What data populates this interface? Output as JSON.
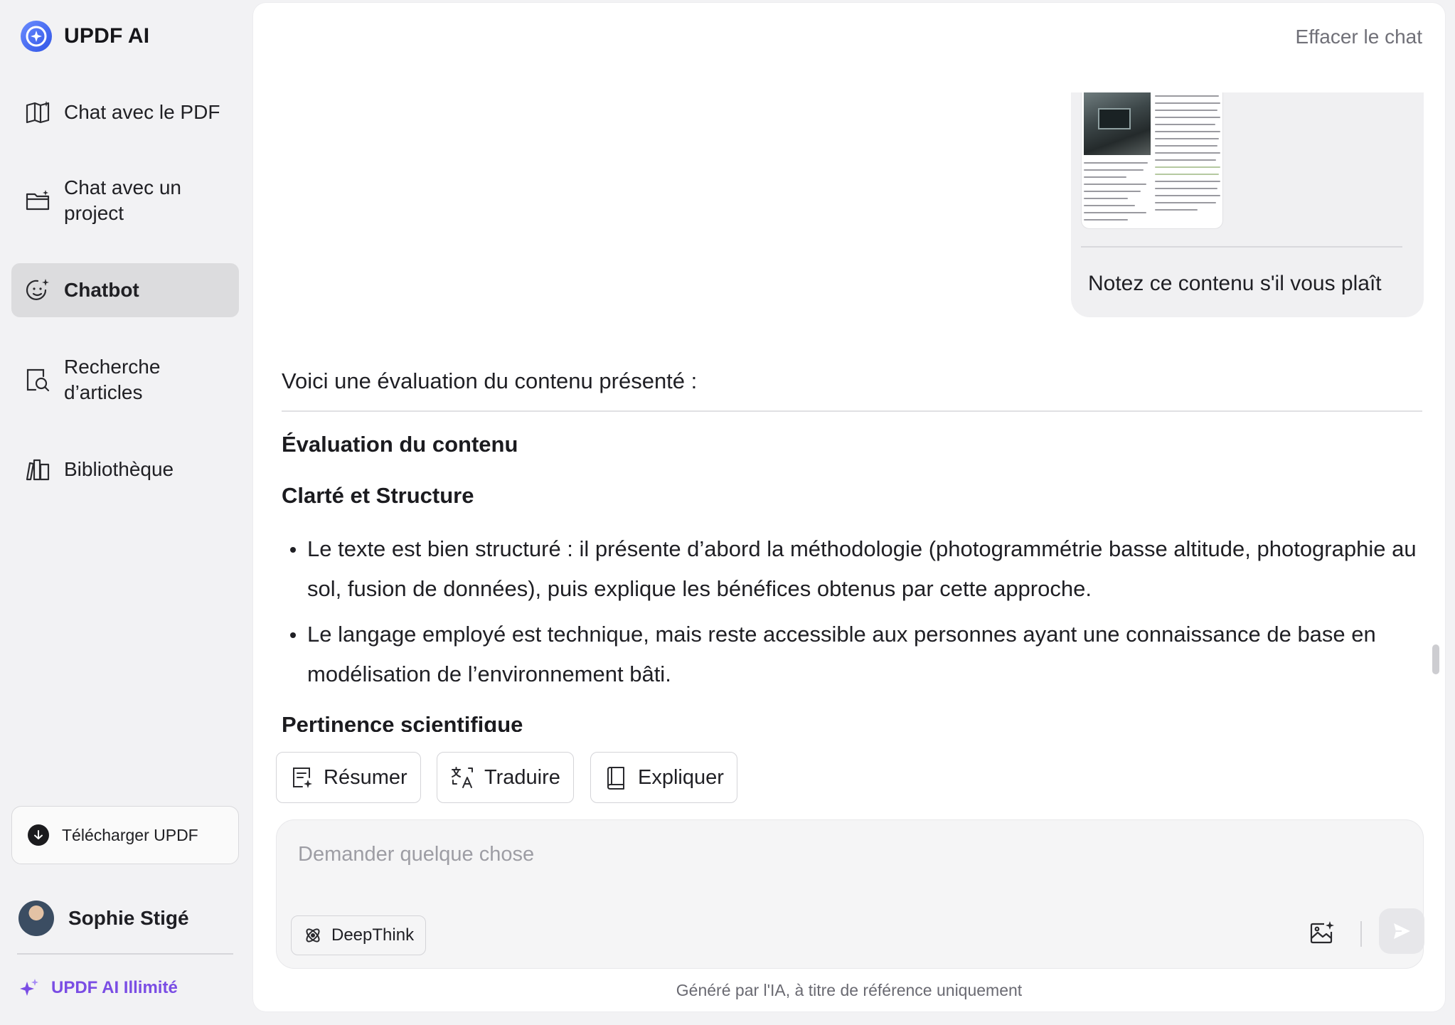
{
  "app": {
    "name": "UPDF AI"
  },
  "sidebar": {
    "items": [
      {
        "label": "Chat avec le PDF",
        "icon": "book-sparkle-icon"
      },
      {
        "label": "Chat avec un project",
        "icon": "folder-icon"
      },
      {
        "label": "Chatbot",
        "icon": "chatbot-icon",
        "active": true
      },
      {
        "label": "Recherche d’articles",
        "icon": "search-document-icon"
      },
      {
        "label": "Bibliothèque",
        "icon": "library-icon"
      }
    ],
    "download_label": "Télécharger UPDF",
    "user_name": "Sophie Stigé",
    "unlimited_label": "UPDF AI Illimité"
  },
  "header": {
    "clear_chat": "Effacer le chat"
  },
  "conversation": {
    "user_message": "Notez ce contenu s'il vous plaît",
    "ai_intro": "Voici une évaluation du contenu présenté :",
    "heading_1": "Évaluation du contenu",
    "heading_2": "Clarté et Structure",
    "bullets": [
      "Le texte est bien structuré : il présente d’abord la méthodologie (photogrammétrie basse altitude, photographie au sol, fusion de données), puis explique les bénéfices obtenus par cette approche.",
      "Le langage employé est technique, mais reste accessible aux personnes ayant une connaissance de base en modélisation de l’environnement bâti."
    ],
    "heading_3": "Pertinence scientifique"
  },
  "actions": {
    "summarize": "Résumer",
    "translate": "Traduire",
    "explain": "Expliquer"
  },
  "input": {
    "placeholder": "Demander quelque chose",
    "value": "",
    "deepthink_label": "DeepThink"
  },
  "footer": {
    "disclaimer": "Généré par l'IA, à titre de référence uniquement"
  },
  "colors": {
    "accent": "#7a4de4",
    "logo_blue": "#3d6cf2"
  }
}
